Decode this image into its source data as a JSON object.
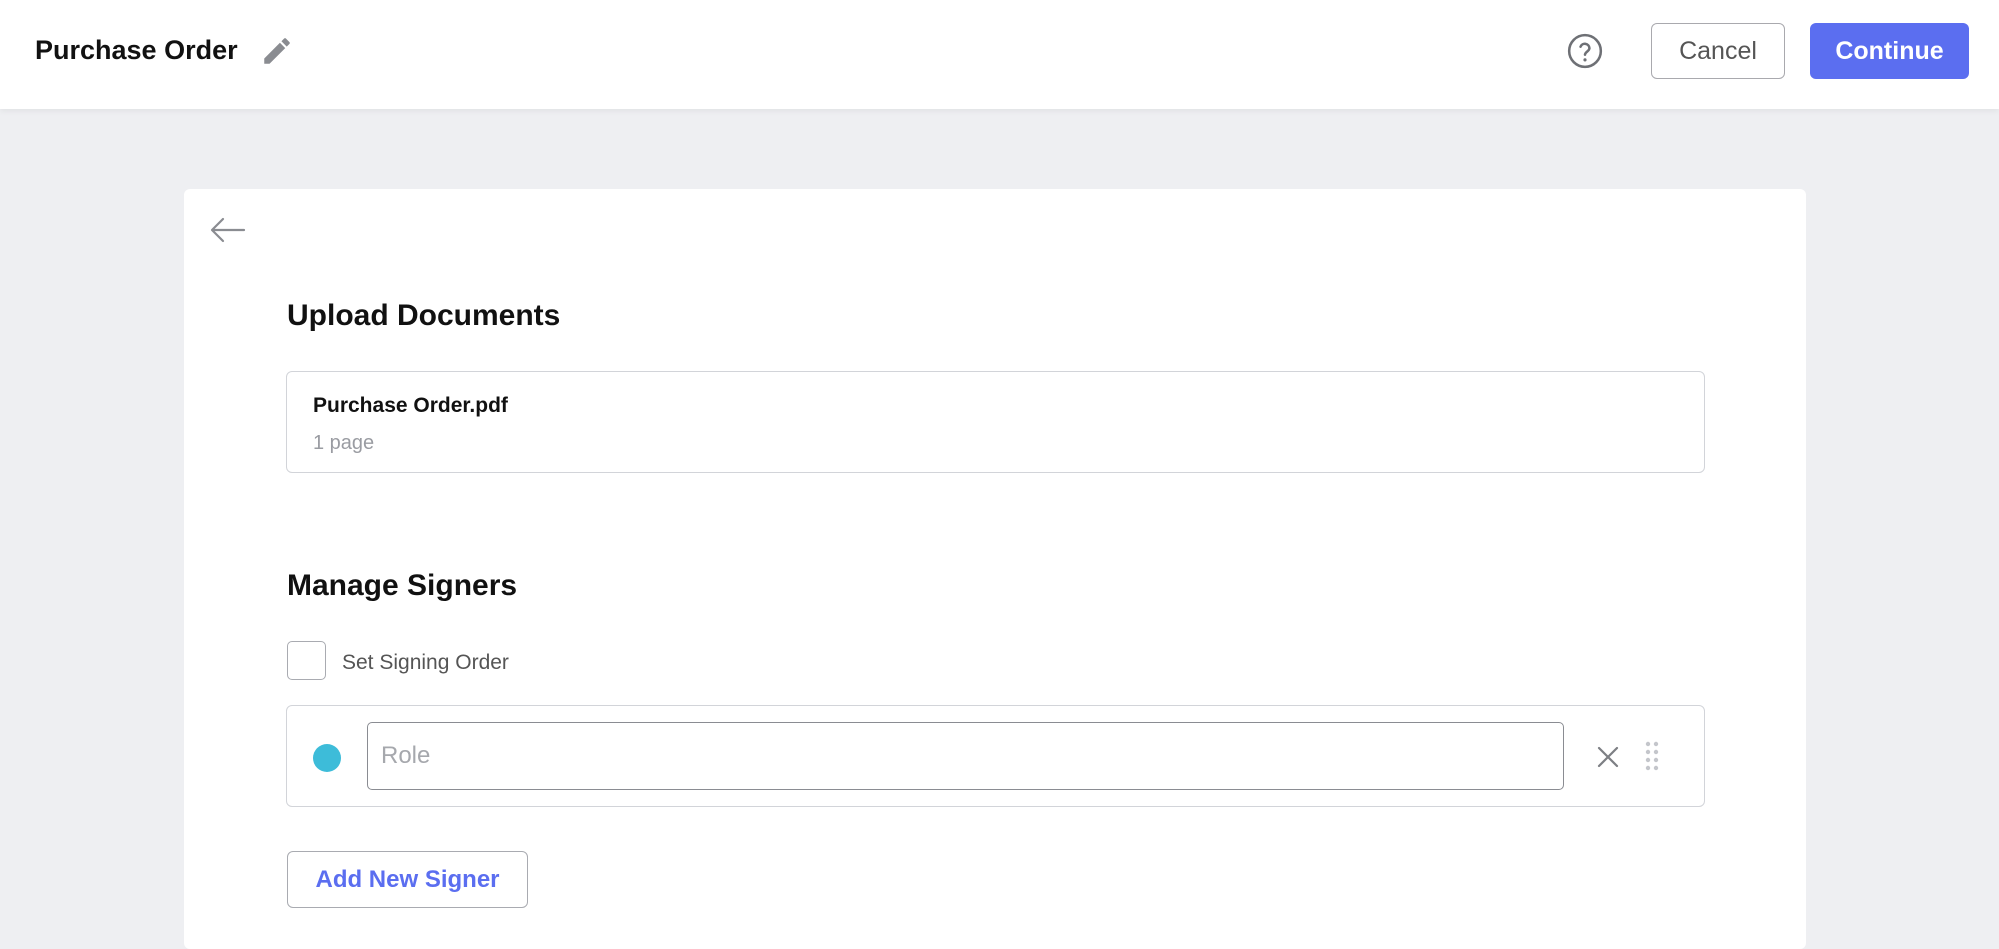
{
  "header": {
    "title": "Purchase Order",
    "cancel_label": "Cancel",
    "continue_label": "Continue"
  },
  "upload": {
    "section_title": "Upload Documents",
    "document": {
      "name": "Purchase Order.pdf",
      "pages": "1 page"
    }
  },
  "signers": {
    "section_title": "Manage Signers",
    "signing_order_label": "Set Signing Order",
    "signing_order_checked": false,
    "items": [
      {
        "role_placeholder": "Role",
        "role_value": "",
        "color": "#3dbcd9"
      }
    ],
    "add_label": "Add New Signer"
  },
  "colors": {
    "accent": "#5b6ef0",
    "signer_1": "#3dbcd9",
    "background": "#eeeff2"
  }
}
